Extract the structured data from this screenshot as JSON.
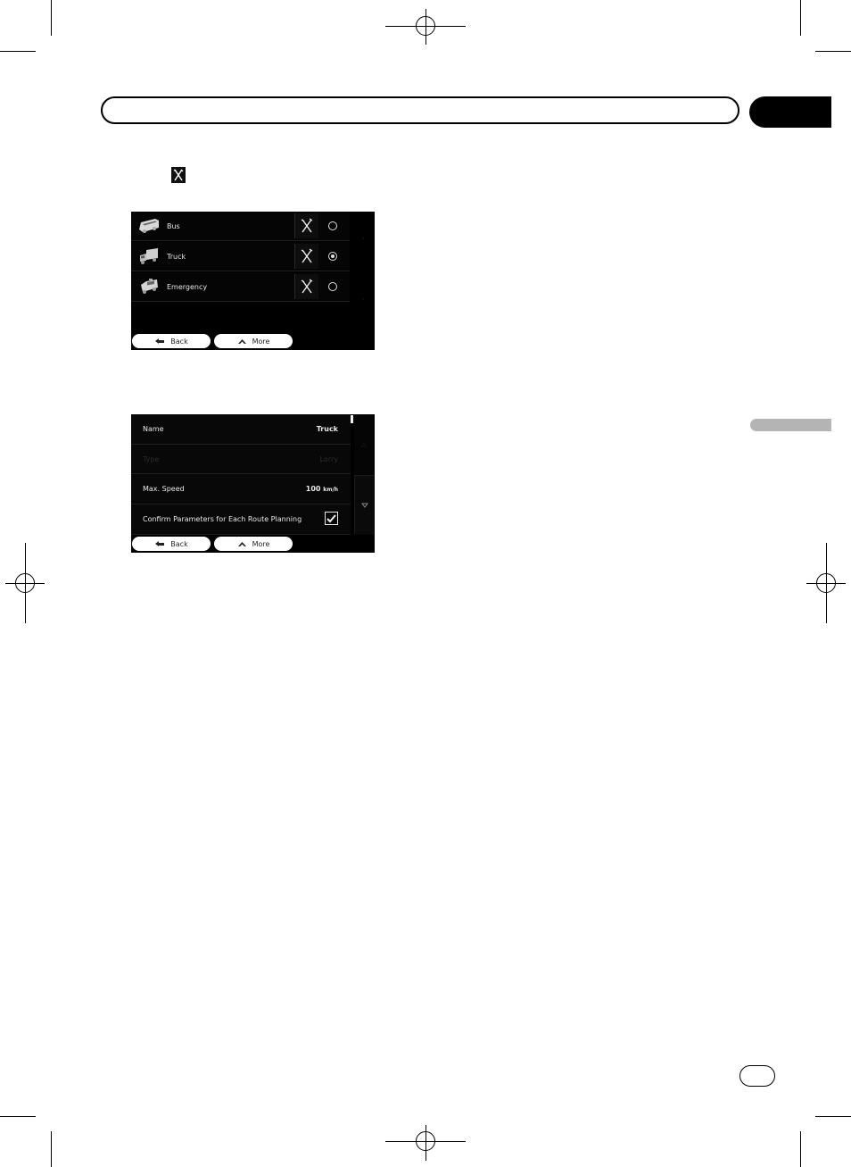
{
  "vehicle_list": {
    "items": [
      {
        "label": "Bus",
        "icon": "bus-icon",
        "selected": false
      },
      {
        "label": "Truck",
        "icon": "truck-icon",
        "selected": true
      },
      {
        "label": "Emergency",
        "icon": "emergency-vehicle-icon",
        "selected": false
      }
    ],
    "back_label": "Back",
    "more_label": "More"
  },
  "vehicle_settings": {
    "name_label": "Name",
    "name_value": "Truck",
    "type_label": "Type",
    "type_value": "Lorry",
    "speed_label": "Max. Speed",
    "speed_value": "100",
    "speed_unit": "km/h",
    "confirm_label": "Confirm Parameters for Each Route Planning",
    "confirm_checked": true,
    "back_label": "Back",
    "more_label": "More"
  },
  "colors": {
    "screen_bg": "#000000",
    "text": "#e8e8e8",
    "button_bg": "#ffffff",
    "side_tab": "#b4b4b4"
  }
}
